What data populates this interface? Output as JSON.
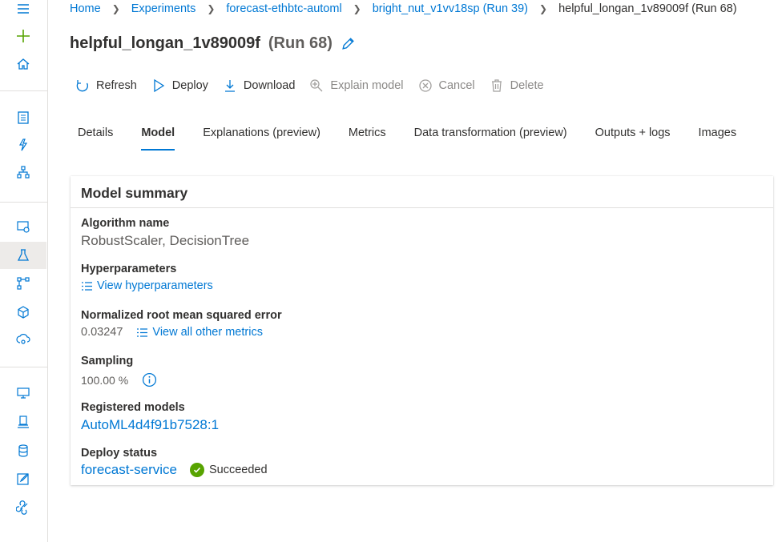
{
  "breadcrumb": {
    "items": [
      "Home",
      "Experiments",
      "forecast-ethbtc-automl",
      "bright_nut_v1vv18sp (Run 39)"
    ],
    "current": "helpful_longan_1v89009f (Run 68)"
  },
  "page": {
    "title": "helpful_longan_1v89009f",
    "run": "(Run 68)"
  },
  "toolbar": {
    "refresh": "Refresh",
    "deploy": "Deploy",
    "download": "Download",
    "explain": "Explain model",
    "cancel": "Cancel",
    "delete": "Delete"
  },
  "tabs": [
    "Details",
    "Model",
    "Explanations (preview)",
    "Metrics",
    "Data transformation (preview)",
    "Outputs + logs",
    "Images"
  ],
  "active_tab": "Model",
  "summary": {
    "heading": "Model summary",
    "algorithm_label": "Algorithm name",
    "algorithm_value": "RobustScaler, DecisionTree",
    "hyper_label": "Hyperparameters",
    "hyper_link": "View hyperparameters",
    "nrmse_label": "Normalized root mean squared error",
    "nrmse_value": "0.03247",
    "metrics_link": "View all other metrics",
    "sampling_label": "Sampling",
    "sampling_value": "100.00 %",
    "registered_label": "Registered models",
    "registered_value": "AutoML4d4f91b7528:1",
    "deploy_label": "Deploy status",
    "deploy_link": "forecast-service",
    "deploy_status": "Succeeded"
  },
  "colors": {
    "accent": "#0078d4",
    "success": "#57a300",
    "text": "#323130",
    "muted": "#605e5c"
  }
}
